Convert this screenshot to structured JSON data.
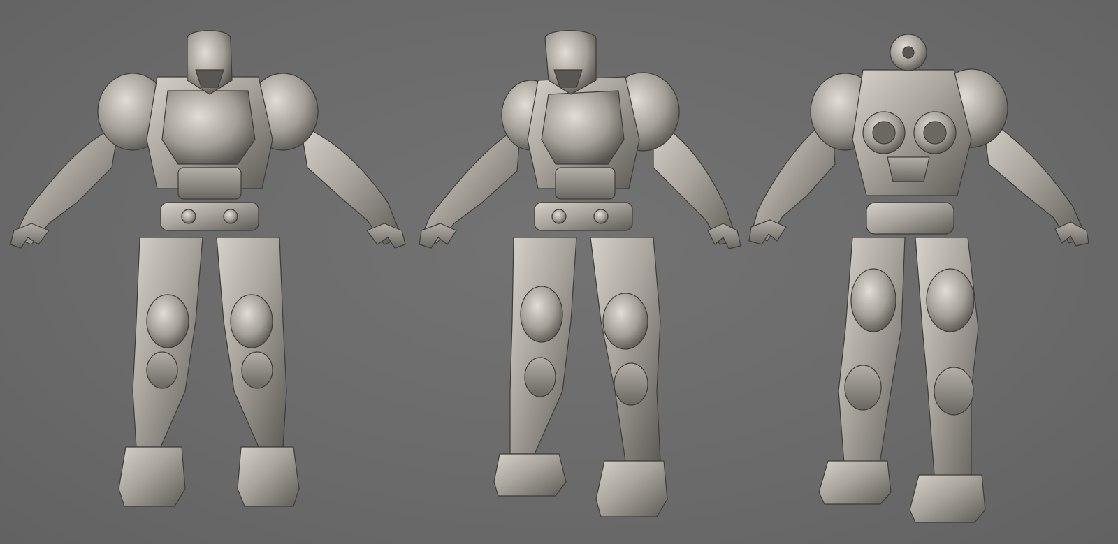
{
  "scene": {
    "background_color": "#6b6b6b",
    "material_color": "#a8a49c",
    "shadow_color": "#4a4844",
    "highlight_color": "#d8d4cc"
  },
  "figures": [
    {
      "view": "front",
      "icon": "armored-figure-front"
    },
    {
      "view": "three-quarter",
      "icon": "armored-figure-three-quarter"
    },
    {
      "view": "back",
      "icon": "armored-figure-back"
    }
  ]
}
